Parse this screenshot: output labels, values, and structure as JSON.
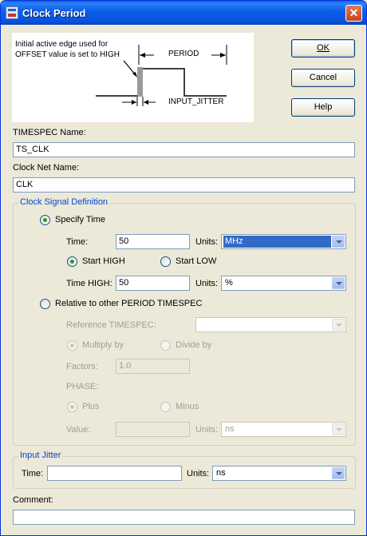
{
  "window": {
    "title": "Clock Period",
    "close_label": "✕"
  },
  "diagram": {
    "note_line1": "Initial active edge used for",
    "note_line2": "OFFSET value is set to HIGH",
    "period_label": "PERIOD",
    "jitter_label": "INPUT_JITTER"
  },
  "buttons": {
    "ok": "OK",
    "cancel": "Cancel",
    "help": "Help"
  },
  "timespec_name": {
    "label": "TIMESPEC Name:",
    "value": "TS_CLK"
  },
  "clock_net_name": {
    "label": "Clock Net Name:",
    "value": "CLK"
  },
  "clock_signal": {
    "legend": "Clock Signal Definition",
    "specify_time": {
      "label": "Specify Time",
      "selected": true,
      "time_label": "Time:",
      "time_value": "50",
      "units_label": "Units:",
      "units_value": "MHz",
      "start_high_label": "Start HIGH",
      "start_low_label": "Start LOW",
      "start_high_selected": true,
      "time_high_label": "Time HIGH:",
      "time_high_value": "50",
      "time_high_units_label": "Units:",
      "time_high_units_value": "%"
    },
    "relative": {
      "label": "Relative to other PERIOD TIMESPEC",
      "selected": false,
      "reference_label": "Reference TIMESPEC:",
      "reference_value": "",
      "multiply_label": "Multiply by",
      "divide_label": "Divide by",
      "factors_label": "Factors:",
      "factors_value": "1.0",
      "phase_label": "PHASE:",
      "plus_label": "Plus",
      "minus_label": "Minus",
      "value_label": "Value:",
      "value_value": "",
      "units_label": "Units:",
      "units_value": "ns"
    }
  },
  "input_jitter": {
    "legend": "Input Jitter",
    "time_label": "Time:",
    "time_value": "",
    "units_label": "Units:",
    "units_value": "ns"
  },
  "comment": {
    "label": "Comment:",
    "value": ""
  },
  "colors": {
    "accent": "#0046d5",
    "titlebar": "#0a5ee8",
    "selection": "#316ac5"
  }
}
